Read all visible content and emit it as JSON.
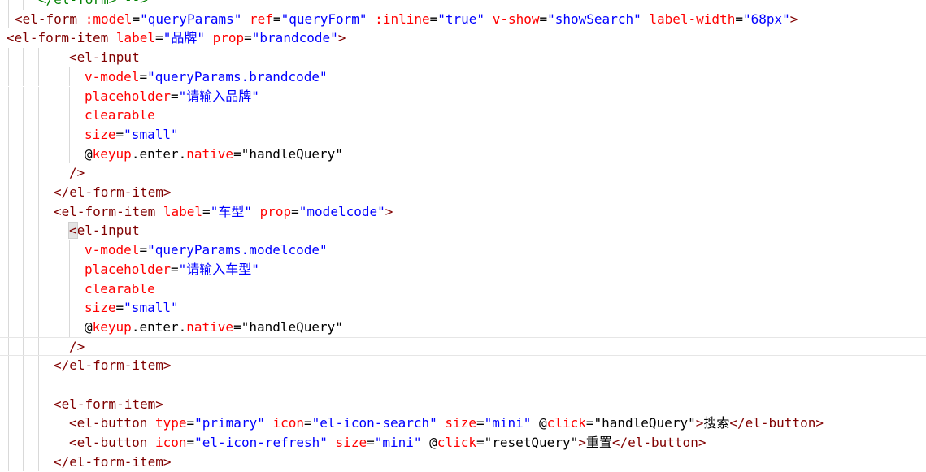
{
  "editor": {
    "lines": [
      {
        "indent": 47,
        "guides": [
          10,
          28
        ],
        "tokens": [
          {
            "t": "cmt",
            "v": "</el-form> -->"
          }
        ]
      },
      {
        "indent": 18,
        "guides": [
          10
        ],
        "tokens": [
          {
            "t": "tag",
            "v": "<el-form"
          },
          {
            "t": "plain",
            "v": " "
          },
          {
            "t": "attr",
            "v": ":model"
          },
          {
            "t": "plain",
            "v": "="
          },
          {
            "t": "val",
            "v": "\"queryParams\""
          },
          {
            "t": "plain",
            "v": " "
          },
          {
            "t": "attr",
            "v": "ref"
          },
          {
            "t": "plain",
            "v": "="
          },
          {
            "t": "val",
            "v": "\"queryForm\""
          },
          {
            "t": "plain",
            "v": " "
          },
          {
            "t": "attr",
            "v": ":inline"
          },
          {
            "t": "plain",
            "v": "="
          },
          {
            "t": "val",
            "v": "\"true\""
          },
          {
            "t": "plain",
            "v": " "
          },
          {
            "t": "attr",
            "v": "v-show"
          },
          {
            "t": "plain",
            "v": "="
          },
          {
            "t": "val",
            "v": "\"showSearch\""
          },
          {
            "t": "plain",
            "v": " "
          },
          {
            "t": "attr",
            "v": "label-width"
          },
          {
            "t": "plain",
            "v": "="
          },
          {
            "t": "val",
            "v": "\"68px\""
          },
          {
            "t": "tag",
            "v": ">"
          }
        ]
      },
      {
        "indent": 8,
        "guides": [],
        "tokens": [
          {
            "t": "tag",
            "v": "<el-form-item"
          },
          {
            "t": "plain",
            "v": " "
          },
          {
            "t": "attr",
            "v": "label"
          },
          {
            "t": "plain",
            "v": "="
          },
          {
            "t": "val",
            "v": "\"品牌\""
          },
          {
            "t": "plain",
            "v": " "
          },
          {
            "t": "attr",
            "v": "prop"
          },
          {
            "t": "plain",
            "v": "="
          },
          {
            "t": "val",
            "v": "\"brandcode\""
          },
          {
            "t": "tag",
            "v": ">"
          }
        ]
      },
      {
        "indent": 85,
        "guides": [
          10,
          28,
          47,
          66
        ],
        "tokens": [
          {
            "t": "tag",
            "v": "<el-input"
          }
        ]
      },
      {
        "indent": 104,
        "guides": [
          10,
          28,
          47,
          66,
          85
        ],
        "tokens": [
          {
            "t": "attr",
            "v": "v-model"
          },
          {
            "t": "plain",
            "v": "="
          },
          {
            "t": "val",
            "v": "\"queryParams.brandcode\""
          }
        ]
      },
      {
        "indent": 104,
        "guides": [
          10,
          28,
          47,
          66,
          85
        ],
        "tokens": [
          {
            "t": "attr",
            "v": "placeholder"
          },
          {
            "t": "plain",
            "v": "="
          },
          {
            "t": "val",
            "v": "\"请输入品牌\""
          }
        ]
      },
      {
        "indent": 104,
        "guides": [
          10,
          28,
          47,
          66,
          85
        ],
        "tokens": [
          {
            "t": "attr",
            "v": "clearable"
          }
        ]
      },
      {
        "indent": 104,
        "guides": [
          10,
          28,
          47,
          66,
          85
        ],
        "tokens": [
          {
            "t": "attr",
            "v": "size"
          },
          {
            "t": "plain",
            "v": "="
          },
          {
            "t": "val",
            "v": "\"small\""
          }
        ]
      },
      {
        "indent": 104,
        "guides": [
          10,
          28,
          47,
          66,
          85
        ],
        "tokens": [
          {
            "t": "plain",
            "v": "@"
          },
          {
            "t": "attr",
            "v": "keyup"
          },
          {
            "t": "plain",
            "v": "."
          },
          {
            "t": "plain",
            "v": "enter"
          },
          {
            "t": "plain",
            "v": "."
          },
          {
            "t": "attr",
            "v": "native"
          },
          {
            "t": "plain",
            "v": "="
          },
          {
            "t": "plain",
            "v": "\"handleQuery\""
          }
        ]
      },
      {
        "indent": 85,
        "guides": [
          10,
          28,
          47,
          66
        ],
        "tokens": [
          {
            "t": "tag",
            "v": "/>"
          }
        ]
      },
      {
        "indent": 66,
        "guides": [
          10,
          28,
          47
        ],
        "tokens": [
          {
            "t": "tag",
            "v": "</el-form-item>"
          }
        ]
      },
      {
        "indent": 66,
        "guides": [
          10,
          28,
          47
        ],
        "tokens": [
          {
            "t": "tag",
            "v": "<el-form-item"
          },
          {
            "t": "plain",
            "v": " "
          },
          {
            "t": "attr",
            "v": "label"
          },
          {
            "t": "plain",
            "v": "="
          },
          {
            "t": "val",
            "v": "\"车型\""
          },
          {
            "t": "plain",
            "v": " "
          },
          {
            "t": "attr",
            "v": "prop"
          },
          {
            "t": "plain",
            "v": "="
          },
          {
            "t": "val",
            "v": "\"modelcode\""
          },
          {
            "t": "tag",
            "v": ">"
          }
        ]
      },
      {
        "indent": 85,
        "guides": [
          10,
          28,
          47,
          66
        ],
        "bracket": true,
        "tokens": [
          {
            "t": "tag",
            "v": "<el-input"
          }
        ]
      },
      {
        "indent": 104,
        "guides": [
          10,
          28,
          47,
          66,
          85
        ],
        "tokens": [
          {
            "t": "attr",
            "v": "v-model"
          },
          {
            "t": "plain",
            "v": "="
          },
          {
            "t": "val",
            "v": "\"queryParams.modelcode\""
          }
        ]
      },
      {
        "indent": 104,
        "guides": [
          10,
          28,
          47,
          66,
          85
        ],
        "tokens": [
          {
            "t": "attr",
            "v": "placeholder"
          },
          {
            "t": "plain",
            "v": "="
          },
          {
            "t": "val",
            "v": "\"请输入车型\""
          }
        ]
      },
      {
        "indent": 104,
        "guides": [
          10,
          28,
          47,
          66,
          85
        ],
        "tokens": [
          {
            "t": "attr",
            "v": "clearable"
          }
        ]
      },
      {
        "indent": 104,
        "guides": [
          10,
          28,
          47,
          66,
          85
        ],
        "tokens": [
          {
            "t": "attr",
            "v": "size"
          },
          {
            "t": "plain",
            "v": "="
          },
          {
            "t": "val",
            "v": "\"small\""
          }
        ]
      },
      {
        "indent": 104,
        "guides": [
          10,
          28,
          47,
          66,
          85
        ],
        "tokens": [
          {
            "t": "plain",
            "v": "@"
          },
          {
            "t": "attr",
            "v": "keyup"
          },
          {
            "t": "plain",
            "v": "."
          },
          {
            "t": "plain",
            "v": "enter"
          },
          {
            "t": "plain",
            "v": "."
          },
          {
            "t": "attr",
            "v": "native"
          },
          {
            "t": "plain",
            "v": "="
          },
          {
            "t": "plain",
            "v": "\"handleQuery\""
          }
        ]
      },
      {
        "indent": 85,
        "guides": [
          10,
          28,
          47,
          66
        ],
        "current": true,
        "cursor": true,
        "tokens": [
          {
            "t": "tag",
            "v": "/"
          },
          {
            "t": "tag",
            "v": ">"
          }
        ]
      },
      {
        "indent": 66,
        "guides": [
          10,
          28,
          47
        ],
        "tokens": [
          {
            "t": "tag",
            "v": "</el-form-item>"
          }
        ]
      },
      {
        "indent": 66,
        "guides": [
          10,
          28,
          47
        ],
        "tokens": []
      },
      {
        "indent": 66,
        "guides": [
          10,
          28,
          47
        ],
        "tokens": [
          {
            "t": "tag",
            "v": "<el-form-item>"
          }
        ]
      },
      {
        "indent": 85,
        "guides": [
          10,
          28,
          47,
          66
        ],
        "tokens": [
          {
            "t": "tag",
            "v": "<el-button"
          },
          {
            "t": "plain",
            "v": " "
          },
          {
            "t": "attr",
            "v": "type"
          },
          {
            "t": "plain",
            "v": "="
          },
          {
            "t": "val",
            "v": "\"primary\""
          },
          {
            "t": "plain",
            "v": " "
          },
          {
            "t": "attr",
            "v": "icon"
          },
          {
            "t": "plain",
            "v": "="
          },
          {
            "t": "val",
            "v": "\"el-icon-search\""
          },
          {
            "t": "plain",
            "v": " "
          },
          {
            "t": "attr",
            "v": "size"
          },
          {
            "t": "plain",
            "v": "="
          },
          {
            "t": "val",
            "v": "\"mini\""
          },
          {
            "t": "plain",
            "v": " "
          },
          {
            "t": "plain",
            "v": "@"
          },
          {
            "t": "attr",
            "v": "click"
          },
          {
            "t": "plain",
            "v": "="
          },
          {
            "t": "plain",
            "v": "\"handleQuery\""
          },
          {
            "t": "tag",
            "v": ">"
          },
          {
            "t": "plain",
            "v": "搜索"
          },
          {
            "t": "tag",
            "v": "</el-button>"
          }
        ]
      },
      {
        "indent": 85,
        "guides": [
          10,
          28,
          47,
          66
        ],
        "tokens": [
          {
            "t": "tag",
            "v": "<el-button"
          },
          {
            "t": "plain",
            "v": " "
          },
          {
            "t": "attr",
            "v": "icon"
          },
          {
            "t": "plain",
            "v": "="
          },
          {
            "t": "val",
            "v": "\"el-icon-refresh\""
          },
          {
            "t": "plain",
            "v": " "
          },
          {
            "t": "attr",
            "v": "size"
          },
          {
            "t": "plain",
            "v": "="
          },
          {
            "t": "val",
            "v": "\"mini\""
          },
          {
            "t": "plain",
            "v": " "
          },
          {
            "t": "plain",
            "v": "@"
          },
          {
            "t": "attr",
            "v": "click"
          },
          {
            "t": "plain",
            "v": "="
          },
          {
            "t": "plain",
            "v": "\"resetQuery\""
          },
          {
            "t": "tag",
            "v": ">"
          },
          {
            "t": "plain",
            "v": "重置"
          },
          {
            "t": "tag",
            "v": "</el-button>"
          }
        ]
      },
      {
        "indent": 66,
        "guides": [
          10,
          28,
          47
        ],
        "tokens": [
          {
            "t": "tag",
            "v": "</el-form-item>"
          }
        ]
      }
    ]
  },
  "colors": {
    "tag": "#800000",
    "attribute": "#ff0000",
    "value": "#0000ff",
    "comment": "#008000",
    "text": "#000000",
    "background": "#ffffff"
  }
}
